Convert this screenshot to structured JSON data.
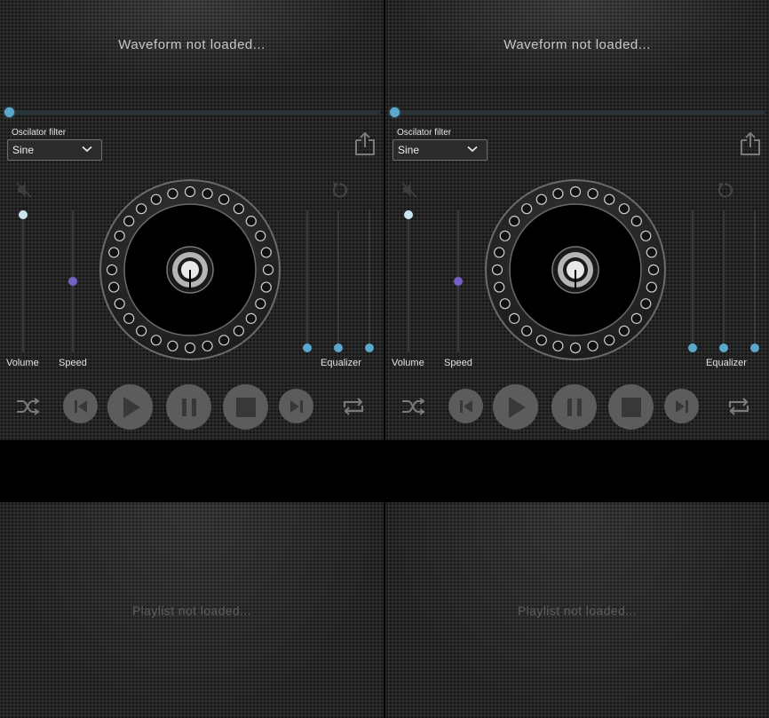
{
  "decks": [
    {
      "waveform": {
        "status_text": "Waveform not loaded..."
      },
      "oscillator": {
        "label": "Oscilator filter",
        "selected": "Sine"
      },
      "sliders": {
        "volume_label": "Volume",
        "speed_label": "Speed",
        "equalizer_label": "Equalizer"
      },
      "playlist": {
        "status_text": "Playlist not loaded..."
      }
    },
    {
      "waveform": {
        "status_text": "Waveform not loaded..."
      },
      "oscillator": {
        "label": "Oscilator filter",
        "selected": "Sine"
      },
      "sliders": {
        "volume_label": "Volume",
        "speed_label": "Speed",
        "equalizer_label": "Equalizer"
      },
      "playlist": {
        "status_text": "Playlist not loaded..."
      }
    }
  ],
  "slider_values": {
    "seek_position": 0,
    "volume": 1.0,
    "speed": 0.5,
    "equalizer_bands": [
      0,
      0,
      0
    ]
  },
  "colors": {
    "accent_blue": "#5aa8cc",
    "volume_thumb": "#c9e6ee",
    "speed_thumb": "#7560c8",
    "button_fill": "#5c5c5c",
    "icon_dark": "#3a3a3a"
  },
  "icons": {
    "mute": "mute-icon",
    "reset": "reset-icon",
    "share": "share-icon",
    "shuffle": "shuffle-icon",
    "previous": "previous-icon",
    "play": "play-icon",
    "pause": "pause-icon",
    "stop": "stop-icon",
    "next": "next-icon",
    "repeat": "repeat-icon"
  }
}
